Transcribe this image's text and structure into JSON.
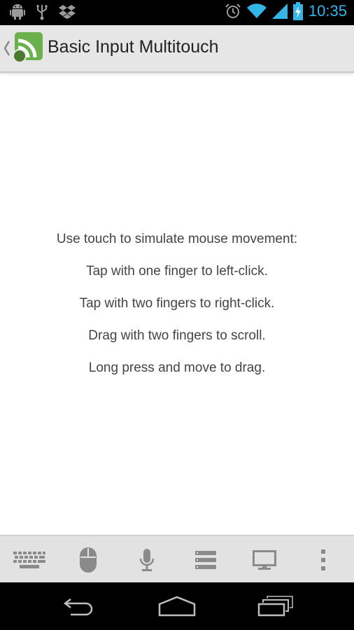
{
  "status_bar": {
    "left_icons": [
      "android-debug-icon",
      "usb-icon",
      "dropbox-icon"
    ],
    "right_icons": [
      "alarm-icon",
      "wifi-icon",
      "signal-icon",
      "battery-charging-icon"
    ],
    "time": "10:35",
    "accent_color": "#33b5e5"
  },
  "action_bar": {
    "title": "Basic Input Multitouch",
    "logo_color": "#6ab04c"
  },
  "instructions": [
    "Use touch to simulate mouse movement:",
    "Tap with one finger to left-click.",
    "Tap with two fingers to right-click.",
    "Drag with two fingers to scroll.",
    "Long press and move to drag."
  ],
  "toolbar": {
    "items": [
      "keyboard-icon",
      "mouse-icon",
      "microphone-icon",
      "list-icon",
      "monitor-icon",
      "overflow-menu-icon"
    ]
  },
  "nav_bar": {
    "items": [
      "back-icon",
      "home-icon",
      "recent-apps-icon"
    ]
  }
}
